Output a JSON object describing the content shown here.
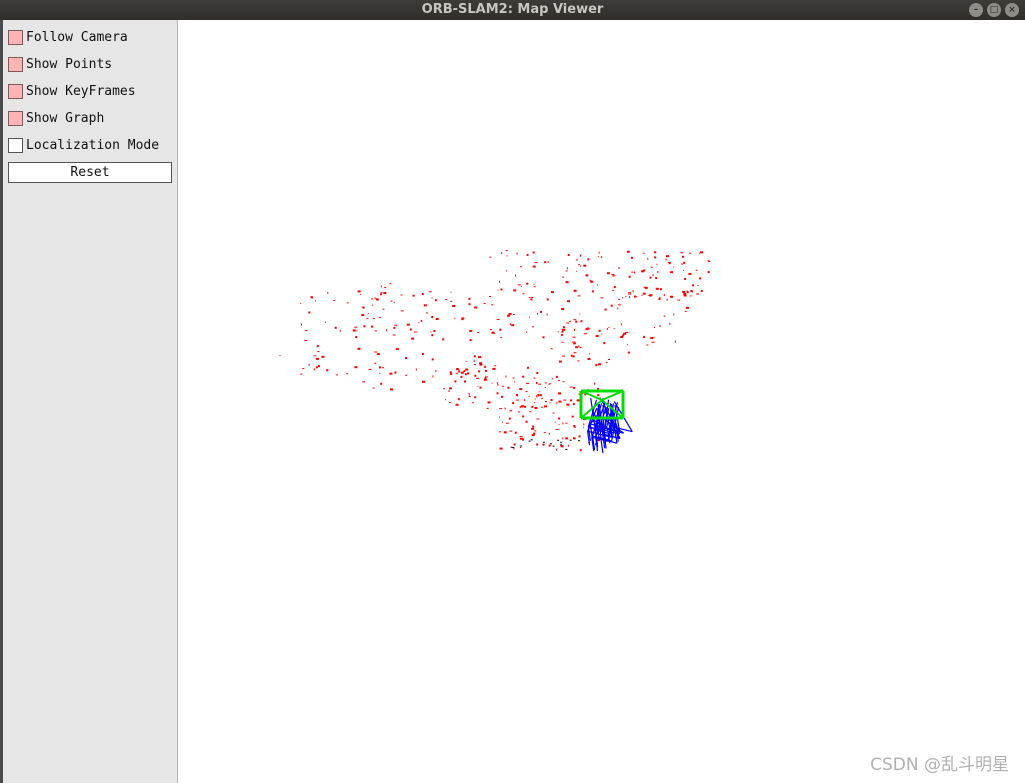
{
  "window": {
    "title": "ORB-SLAM2: Map Viewer"
  },
  "panel": {
    "options": [
      {
        "label": "Follow Camera",
        "checked": true
      },
      {
        "label": "Show Points",
        "checked": true
      },
      {
        "label": "Show KeyFrames",
        "checked": true
      },
      {
        "label": "Show Graph",
        "checked": true
      },
      {
        "label": "Localization Mode",
        "checked": false
      }
    ],
    "reset_label": "Reset"
  },
  "viewer": {
    "point_color": "#ff0000",
    "keyframe_color": "#0000ff",
    "current_camera_color": "#00dd00"
  },
  "watermark": "CSDN @乱斗明星"
}
